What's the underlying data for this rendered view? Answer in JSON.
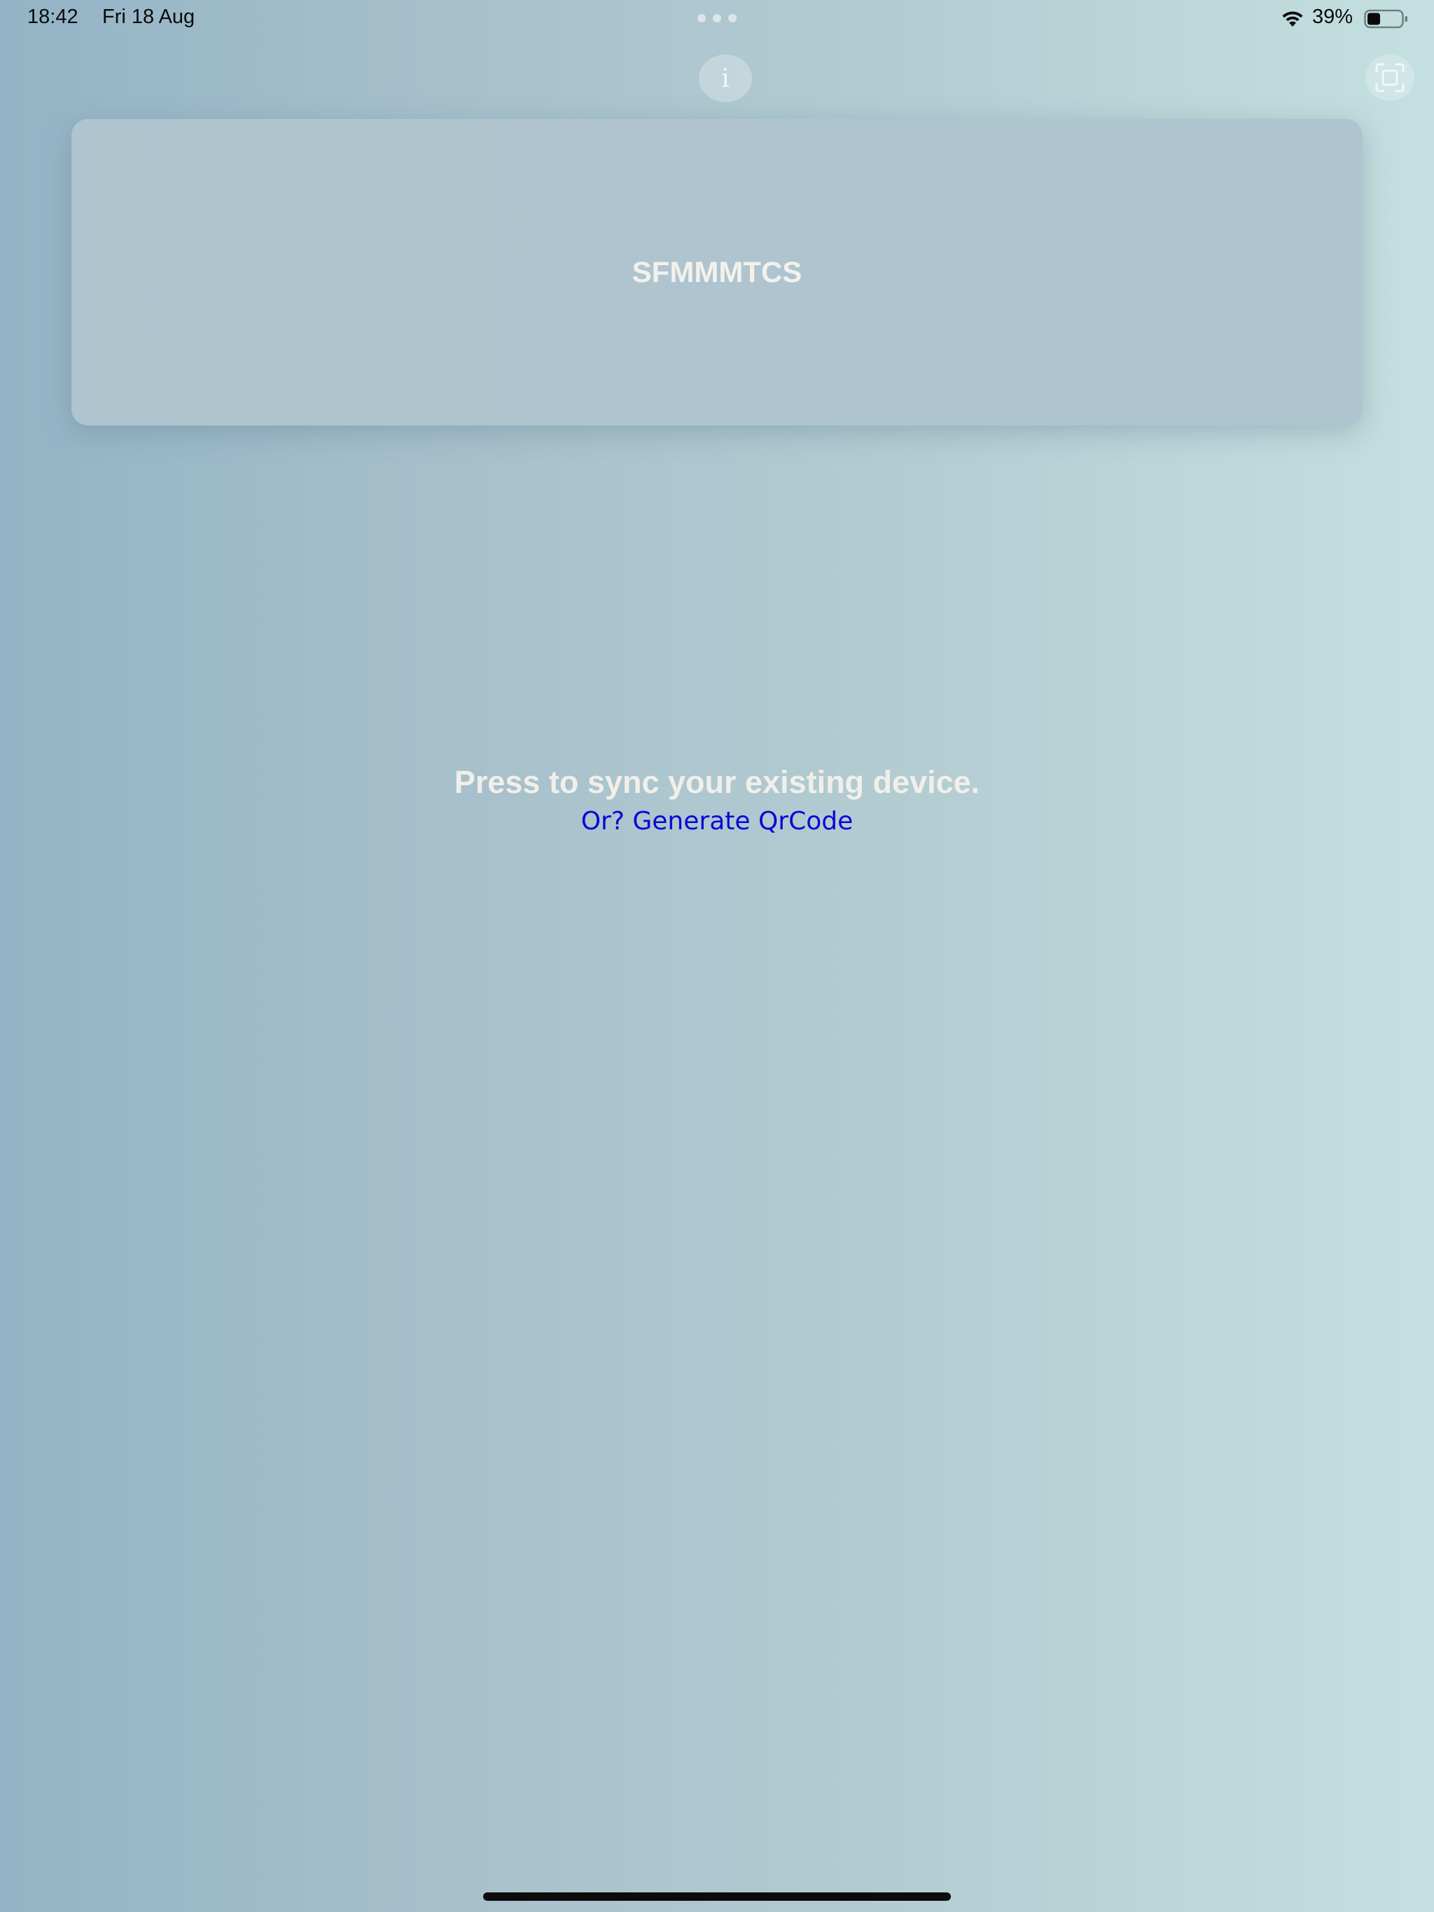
{
  "status_bar": {
    "time": "18:42",
    "date": "Fri 18 Aug",
    "battery_percent": "39%",
    "battery_level": 0.39,
    "wifi_icon": "wifi-icon",
    "battery_icon": "battery-icon"
  },
  "toolbar": {
    "info_label": "i",
    "info_icon": "info-icon",
    "scan_icon": "scan-frame-icon"
  },
  "device_card": {
    "code": "SFMMMTCS"
  },
  "sync": {
    "prompt": "Press to sync your existing device.",
    "qr_link": "Or? Generate QrCode"
  },
  "colors": {
    "background_left": "#93b4c6",
    "background_right": "#c5e0e0",
    "link": "#0a08d6",
    "text_light": "#f1efe9"
  }
}
